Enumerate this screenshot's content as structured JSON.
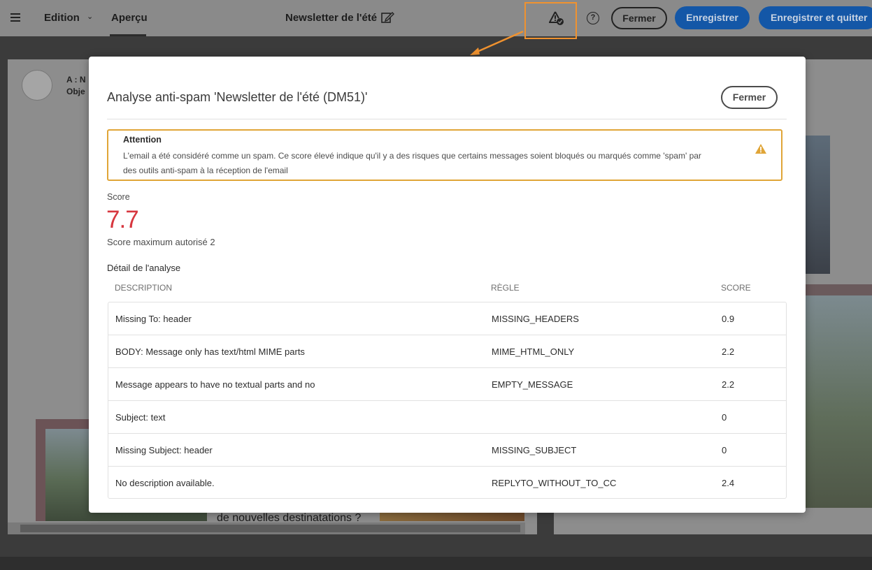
{
  "topbar": {
    "tab_edition": "Edition",
    "tab_apercu": "Aperçu",
    "doc_title": "Newsletter de l'été",
    "close_label": "Fermer",
    "save_label": "Enregistrer",
    "save_quit_label": "Enregistrer et quitter"
  },
  "background": {
    "to_label": "A : N",
    "obj_label": "Obje",
    "headline": "de nouvelles destinatations ?"
  },
  "modal": {
    "title": "Analyse anti-spam 'Newsletter de l'été (DM51)'",
    "close_label": "Fermer",
    "alert": {
      "title": "Attention",
      "text": "L'email a été considéré comme un spam. Ce score élevé indique qu'il y a des risques que certains messages soient bloqués ou marqués comme 'spam' par des outils anti-spam à la réception de l'email"
    },
    "score_label": "Score",
    "score_value": "7.7",
    "score_max": "Score maximum autorisé 2",
    "detail_title": "Détail de l'analyse",
    "columns": [
      "DESCRIPTION",
      "RÈGLE",
      "SCORE"
    ],
    "rows": [
      {
        "description": "Missing To: header",
        "rule": "MISSING_HEADERS",
        "score": "0.9"
      },
      {
        "description": "BODY: Message only has text/html MIME parts",
        "rule": "MIME_HTML_ONLY",
        "score": "2.2"
      },
      {
        "description": "Message appears to have no textual parts and no",
        "rule": "EMPTY_MESSAGE",
        "score": "2.2"
      },
      {
        "description": "Subject: text",
        "rule": "",
        "score": "0"
      },
      {
        "description": "Missing Subject: header",
        "rule": "MISSING_SUBJECT",
        "score": "0"
      },
      {
        "description": "No description available.",
        "rule": "REPLYTO_WITHOUT_TO_CC",
        "score": "2.4"
      }
    ]
  },
  "colors": {
    "accent_blue": "#1457a7",
    "score_red": "#d7373f",
    "warning_orange": "#e0a537",
    "highlight_orange": "#f0922f"
  },
  "icons": [
    "menu-icon",
    "chevron-down-icon",
    "edit-icon",
    "spam-check-icon",
    "help-icon",
    "warning-icon"
  ]
}
